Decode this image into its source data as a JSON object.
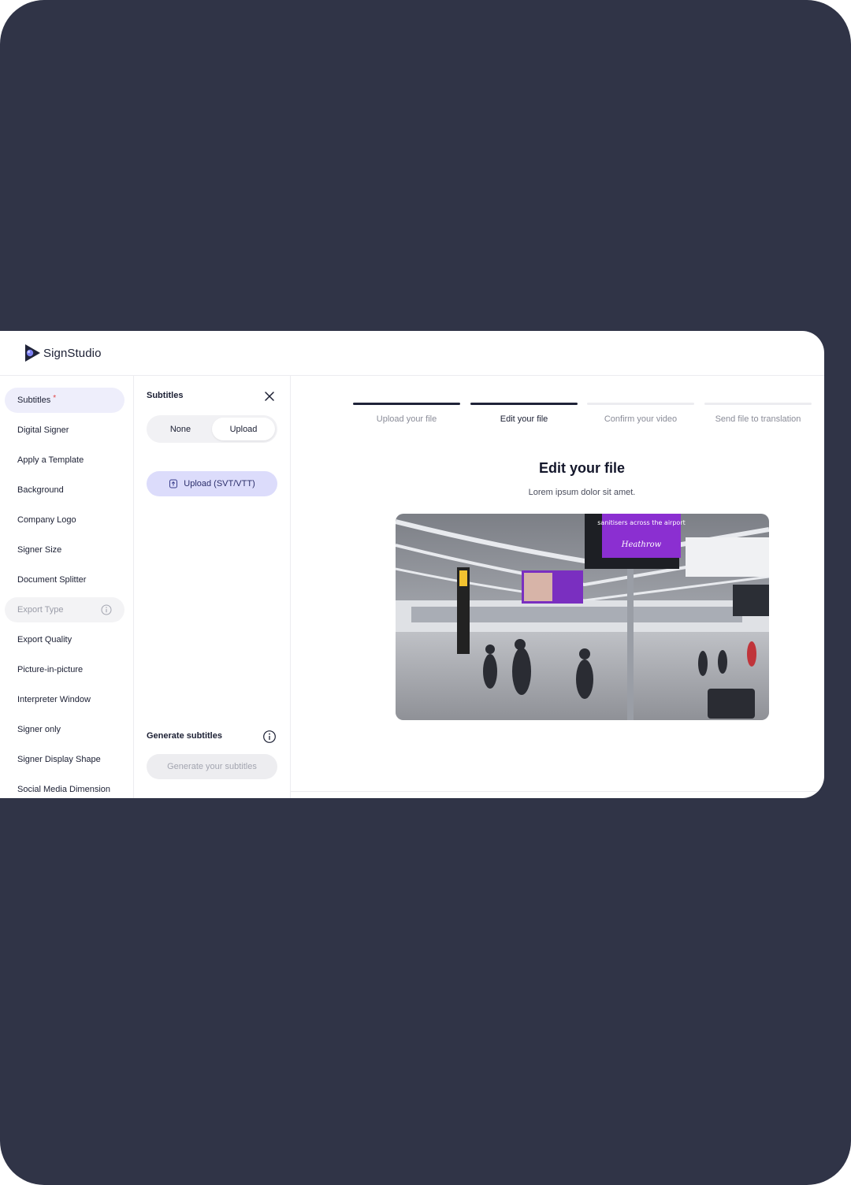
{
  "app": {
    "brand": "SignStudio"
  },
  "sidebar": {
    "items": [
      {
        "label": "Subtitles",
        "state": "active",
        "required": "*"
      },
      {
        "label": "Digital Signer",
        "state": "default"
      },
      {
        "label": "Apply a Template",
        "state": "default"
      },
      {
        "label": "Background",
        "state": "default"
      },
      {
        "label": "Company Logo",
        "state": "default"
      },
      {
        "label": "Signer Size",
        "state": "default"
      },
      {
        "label": "Document Splitter",
        "state": "default"
      },
      {
        "label": "Export Type",
        "state": "disabled",
        "icon": "info-icon"
      },
      {
        "label": "Export Quality",
        "state": "default"
      },
      {
        "label": "Picture-in-picture",
        "state": "default"
      },
      {
        "label": "Interpreter Window",
        "state": "default"
      },
      {
        "label": "Signer only",
        "state": "default"
      },
      {
        "label": "Signer Display Shape",
        "state": "default"
      },
      {
        "label": "Social Media Dimension",
        "state": "default"
      }
    ]
  },
  "panel": {
    "title": "Subtitles",
    "close_icon": "close-icon",
    "toggle": {
      "options": [
        "None",
        "Upload"
      ],
      "selected": "Upload"
    },
    "upload_button": "Upload (SVT/VTT)",
    "generate_title": "Generate subtitles",
    "generate_button": "Generate your subtitles"
  },
  "steps": [
    {
      "label": "Upload your file",
      "status": "done"
    },
    {
      "label": "Edit your file",
      "status": "current"
    },
    {
      "label": "Confirm your video",
      "status": "pending"
    },
    {
      "label": "Send file to translation",
      "status": "pending"
    }
  ],
  "main": {
    "title": "Edit your file",
    "subtitle": "Lorem ipsum dolor sit amet."
  },
  "preview": {
    "sign_text_1": "sanitisers across the airport",
    "sign_brand": "Heathrow"
  },
  "colors": {
    "frame": "#303447",
    "accent_bg": "#dcdcfb",
    "active_nav": "#eeeefb",
    "step_done": "#1f2338",
    "required": "#e04444"
  }
}
